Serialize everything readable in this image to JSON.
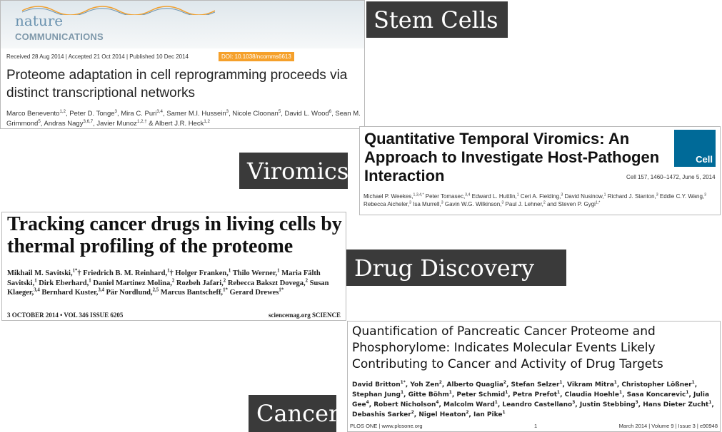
{
  "labels": {
    "stem_cells": "Stem Cells",
    "viromics": "Viromics",
    "drug_discovery": "Drug Discovery",
    "cancer": "Cancer"
  },
  "nature": {
    "logo_top": "nature",
    "logo_bottom": "COMMUNICATIONS",
    "meta": "Received 28 Aug 2014 | Accepted 21 Oct 2014 | Published 10 Dec 2014",
    "doi": "DOI: 10.1038/ncomms6613",
    "title": "Proteome adaptation in cell reprogramming proceeds via distinct transcriptional networks",
    "authors_html": "Marco Benevento<span class='sup'>1,2</span>, Peter D. Tonge<span class='sup'>3</span>, Mira C. Puri<span class='sup'>3,4</span>, Samer M.I. Hussein<span class='sup'>3</span>, Nicole Cloonan<span class='sup'>5</span>, David L. Wood<span class='sup'>6</span>, Sean M. Grimmond<span class='sup'>5</span>, Andras Nagy<span class='sup'>3,6,7</span>, Javier Munoz<span class='sup'>1,2,†</span> &amp; Albert J.R. Heck<span class='sup'>1,2</span>"
  },
  "cell": {
    "title": "Quantitative Temporal Viromics: An Approach to Investigate Host-Pathogen Interaction",
    "logo": "Cell",
    "citation": "Cell 157, 1460–1472, June 5, 2014",
    "authors_html": "Michael P. Weekes,<span class='sup'>1,3,4,*</span> Peter Tomasec,<span class='sup'>3,4</span> Edward L. Huttlin,<span class='sup'>1</span> Ceri A. Fielding,<span class='sup'>3</span> David Nusinow,<span class='sup'>1</span> Richard J. Stanton,<span class='sup'>3</span> Eddie C.Y. Wang,<span class='sup'>3</span> Rebecca Aicheler,<span class='sup'>3</span> Isa Murrell,<span class='sup'>3</span> Gavin W.G. Wilkinson,<span class='sup'>3</span> Paul J. Lehner,<span class='sup'>2</span> and Steven P. Gygi<span class='sup'>1,*</span>"
  },
  "science": {
    "title": "Tracking cancer drugs in living cells by thermal profiling of the proteome",
    "authors_html": "Mikhail M. Savitski,<span class='sup'>1*</span>† Friedrich B. M. Reinhard,<span class='sup'>1</span>† Holger Franken,<span class='sup'>1</span> Thilo Werner,<span class='sup'>1</span> Maria Fälth Savitski,<span class='sup'>1</span> Dirk Eberhard,<span class='sup'>1</span> Daniel Martinez Molina,<span class='sup'>2</span> Rozbeh Jafari,<span class='sup'>2</span> Rebecca Bakszt Dovega,<span class='sup'>2</span> Susan Klaeger,<span class='sup'>3,4</span> Bernhard Kuster,<span class='sup'>3,4</span> Pär Nordlund,<span class='sup'>2,5</span> Marcus Bantscheff,<span class='sup'>1*</span> Gerard Drewes<span class='sup'>1*</span>",
    "footer_left": "3 OCTOBER 2014 • VOL 346 ISSUE 6205",
    "footer_right": "sciencemag.org  SCIENCE"
  },
  "plos": {
    "title": "Quantification of Pancreatic Cancer Proteome and Phosphorylome: Indicates Molecular Events Likely Contributing to Cancer and Activity of Drug Targets",
    "authors_html": "David Britton<span class='sup'>1*</span>, Yoh Zen<span class='sup'>2</span>, Alberto Quaglia<span class='sup'>2</span>, Stefan Selzer<span class='sup'>1</span>, Vikram Mitra<span class='sup'>1</span>, Christopher Lößner<span class='sup'>1</span>, Stephan Jung<span class='sup'>1</span>, Gitte Böhm<span class='sup'>1</span>, Peter Schmid<span class='sup'>1</span>, Petra Prefot<span class='sup'>1</span>, Claudia Hoehle<span class='sup'>1</span>, Sasa Koncarevic<span class='sup'>1</span>, Julia Gee<span class='sup'>4</span>, Robert Nicholson<span class='sup'>4</span>, Malcolm Ward<span class='sup'>1</span>, Leandro Castellano<span class='sup'>3</span>, Justin Stebbing<span class='sup'>3</span>, Hans Dieter Zucht<span class='sup'>1</span>, Debashis Sarker<span class='sup'>2</span>, Nigel Heaton<span class='sup'>2</span>, Ian Pike<span class='sup'>1</span>",
    "footer_left": "PLOS ONE | www.plosone.org",
    "footer_page": "1",
    "footer_right": "March 2014 | Volume 9 | Issue 3 | e90948"
  }
}
